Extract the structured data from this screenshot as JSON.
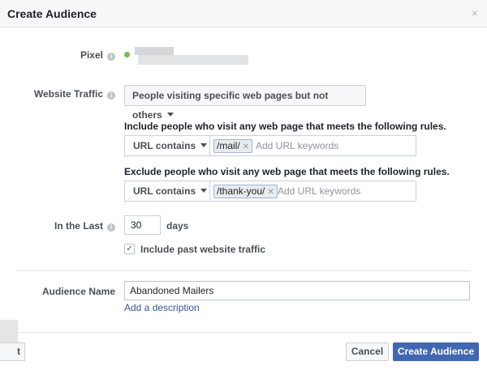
{
  "dialog": {
    "title": "Create Audience",
    "close_glyph": "×"
  },
  "pixel": {
    "label": "Pixel",
    "status_color": "#7dbb52"
  },
  "website_traffic": {
    "label": "Website Traffic",
    "selected": "People visiting specific web pages but not others"
  },
  "include_rule": {
    "heading": "Include people who visit any web page that meets the following rules.",
    "operator": "URL contains",
    "token": "/mail/",
    "placeholder": "Add URL keywords"
  },
  "exclude_rule": {
    "heading": "Exclude people who visit any web page that meets the following rules.",
    "operator": "URL contains",
    "token": "/thank-you/",
    "placeholder": "Add URL keywords"
  },
  "in_the_last": {
    "label": "In the Last",
    "value": "30",
    "unit": "days"
  },
  "past_traffic": {
    "label": "Include past website traffic",
    "checked": true
  },
  "audience_name": {
    "label": "Audience Name",
    "value": "Abandoned Mailers",
    "add_description": "Add a description"
  },
  "footer": {
    "cancel_label": "Cancel",
    "create_label": "Create Audience",
    "stub_label": "t"
  },
  "colors": {
    "primary": "#4267b2",
    "link": "#365899"
  }
}
